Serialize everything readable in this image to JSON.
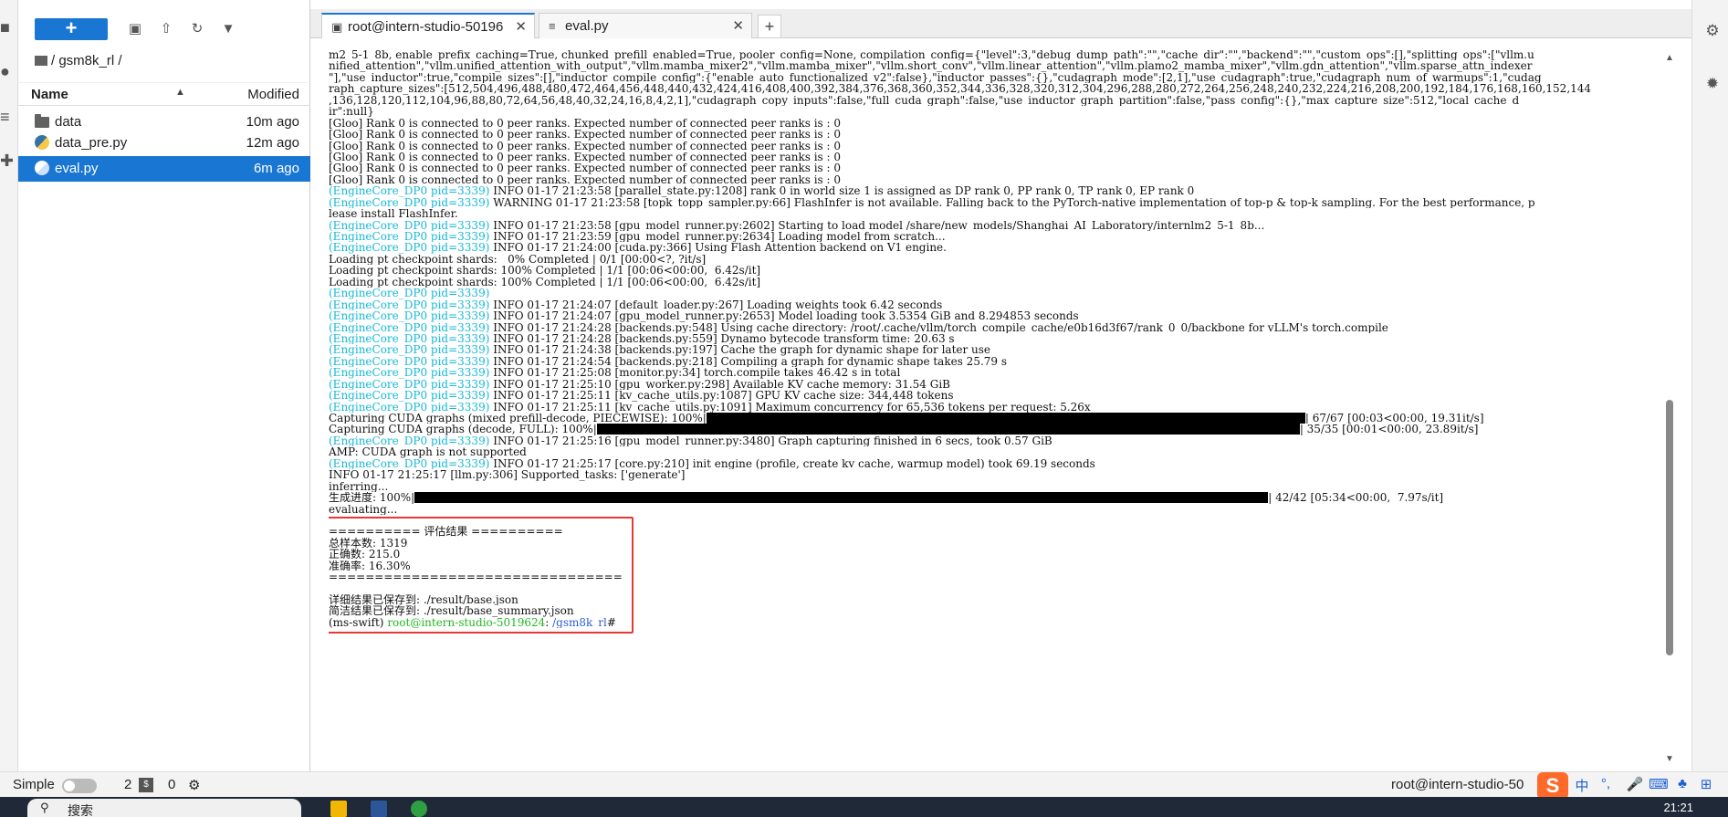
{
  "filebrowser": {
    "new_label": "+",
    "toolbar_icons": [
      "new-folder-icon",
      "upload-icon",
      "refresh-icon",
      "filter-icon"
    ],
    "breadcrumb": "/ gsm8k_rl /",
    "header": {
      "name": "Name",
      "modified": "Modified"
    },
    "files": [
      {
        "name": "data",
        "modified": "10m ago",
        "type": "folder"
      },
      {
        "name": "data_pre.py",
        "modified": "12m ago",
        "type": "python"
      },
      {
        "name": "eval.py",
        "modified": "6m ago",
        "type": "python",
        "selected": true
      }
    ]
  },
  "tabs": [
    {
      "label": "root@intern-studio-50196",
      "icon": "terminal-icon",
      "active": true
    },
    {
      "label": "eval.py",
      "icon": "file-icon",
      "active": false
    }
  ],
  "terminal": {
    "lines": [
      "m2_5-1_8b, enable_prefix_caching=True, chunked_prefill_enabled=True, pooler_config=None, compilation_config={\"level\":3,\"debug_dump_path\":\"\",\"cache_dir\":\"\",\"backend\":\"\",\"custom_ops\":[],\"splitting_ops\":[\"vllm.u",
      "nified_attention\",\"vllm.unified_attention_with_output\",\"vllm.mamba_mixer2\",\"vllm.mamba_mixer\",\"vllm.short_conv\",\"vllm.linear_attention\",\"vllm.plamo2_mamba_mixer\",\"vllm.gdn_attention\",\"vllm.sparse_attn_indexer",
      "\"],\"use_inductor\":true,\"compile_sizes\":[],\"inductor_compile_config\":{\"enable_auto_functionalized_v2\":false},\"inductor_passes\":{},\"cudagraph_mode\":[2,1],\"use_cudagraph\":true,\"cudagraph_num_of_warmups\":1,\"cudag",
      "raph_capture_sizes\":[512,504,496,488,480,472,464,456,448,440,432,424,416,408,400,392,384,376,368,360,352,344,336,328,320,312,304,296,288,280,272,264,256,248,240,232,224,216,208,200,192,184,176,168,160,152,144",
      ",136,128,120,112,104,96,88,80,72,64,56,48,40,32,24,16,8,4,2,1],\"cudagraph_copy_inputs\":false,\"full_cuda_graph\":false,\"use_inductor_graph_partition\":false,\"pass_config\":{},\"max_capture_size\":512,\"local_cache_d",
      "ir\":null}",
      "[Gloo] Rank 0 is connected to 0 peer ranks. Expected number of connected peer ranks is : 0",
      "[Gloo] Rank 0 is connected to 0 peer ranks. Expected number of connected peer ranks is : 0",
      "[Gloo] Rank 0 is connected to 0 peer ranks. Expected number of connected peer ranks is : 0",
      "[Gloo] Rank 0 is connected to 0 peer ranks. Expected number of connected peer ranks is : 0",
      "[Gloo] Rank 0 is connected to 0 peer ranks. Expected number of connected peer ranks is : 0",
      "[Gloo] Rank 0 is connected to 0 peer ranks. Expected number of connected peer ranks is : 0",
      "<P> INFO 01-17 21:23:58 [parallel_state.py:1208] rank 0 in world size 1 is assigned as DP rank 0, PP rank 0, TP rank 0, EP rank 0",
      "<P> WARNING 01-17 21:23:58 [topk_topp_sampler.py:66] FlashInfer is not available. Falling back to the PyTorch-native implementation of top-p & top-k sampling. For the best performance, p",
      "lease install FlashInfer.",
      "<P> INFO 01-17 21:23:58 [gpu_model_runner.py:2602] Starting to load model /share/new_models/Shanghai_AI_Laboratory/internlm2_5-1_8b...",
      "<P> INFO 01-17 21:23:59 [gpu_model_runner.py:2634] Loading model from scratch...",
      "<P> INFO 01-17 21:24:00 [cuda.py:366] Using Flash Attention backend on V1 engine.",
      "Loading pt checkpoint shards:   0% Completed | 0/1 [00:00<?, ?it/s]",
      "Loading pt checkpoint shards: 100% Completed | 1/1 [00:06<00:00,  6.42s/it]",
      "Loading pt checkpoint shards: 100% Completed | 1/1 [00:06<00:00,  6.42s/it]",
      "<P>",
      "<P> INFO 01-17 21:24:07 [default_loader.py:267] Loading weights took 6.42 seconds",
      "<P> INFO 01-17 21:24:07 [gpu_model_runner.py:2653] Model loading took 3.5354 GiB and 8.294853 seconds",
      "<P> INFO 01-17 21:24:28 [backends.py:548] Using cache directory: /root/.cache/vllm/torch_compile_cache/e0b16d3f67/rank_0_0/backbone for vLLM's torch.compile",
      "<P> INFO 01-17 21:24:28 [backends.py:559] Dynamo bytecode transform time: 20.63 s",
      "<P> INFO 01-17 21:24:38 [backends.py:197] Cache the graph for dynamic shape for later use",
      "<P> INFO 01-17 21:24:54 [backends.py:218] Compiling a graph for dynamic shape takes 25.79 s",
      "<P> INFO 01-17 21:25:08 [monitor.py:34] torch.compile takes 46.42 s in total",
      "<P> INFO 01-17 21:25:10 [gpu_worker.py:298] Available KV cache memory: 31.54 GiB",
      "<P> INFO 01-17 21:25:11 [kv_cache_utils.py:1087] GPU KV cache size: 344,448 tokens",
      "<P> INFO 01-17 21:25:11 [kv_cache_utils.py:1091] Maximum concurrency for 65,536 tokens per request: 5.26x",
      "<B1>",
      "<B2>",
      "<P> INFO 01-17 21:25:16 [gpu_model_runner.py:3480] Graph capturing finished in 6 secs, took 0.57 GiB",
      "AMP: CUDA graph is not supported",
      "<P> INFO 01-17 21:25:17 [core.py:210] init engine (profile, create kv cache, warmup model) took 69.19 seconds",
      "INFO 01-17 21:25:17 [llm.py:306] Supported_tasks: ['generate']",
      "inferring...",
      "<B3>",
      "evaluating...",
      "",
      "========== 评估结果 ==========",
      "总样本数: 1319",
      "正确数: 215.0",
      "准确率: 16.30%",
      "================================",
      "",
      "详细结果已保存到: ./result/base.json",
      "简洁结果已保存到: ./result/base_summary.json",
      "<PROMPT>"
    ],
    "engine_prefix": "(EngineCore_DP0 pid=3339)",
    "bar1": {
      "left": "Capturing CUDA graphs (mixed prefill-decode, PIECEWISE): 100%|",
      "right": "| 67/67 [00:03<00:00, 19.31it/s]",
      "progress": 1.0
    },
    "bar2": {
      "left": "Capturing CUDA graphs (decode, FULL): 100%|",
      "right": "| 35/35 [00:01<00:00, 23.89it/s]",
      "progress": 1.0
    },
    "bar3": {
      "left": "生成进度: 100%|",
      "right": "| 42/42 [05:34<00:00,  7.97s/it]",
      "progress": 1.0
    },
    "prompt": {
      "env": "(ms-swift) ",
      "user": "root@intern-studio-5019624",
      "sep": ": ",
      "path": "/gsm8k_rl",
      "end": "#"
    },
    "highlight_color": "#e53935"
  },
  "status": {
    "mode_label": "Simple",
    "count_a": "2",
    "count_b": "0",
    "host": "root@intern-studio-50",
    "ime_lang": "中"
  },
  "taskbar": {
    "search_placeholder": "搜索",
    "clock": "21:21"
  },
  "colors": {
    "accent": "#1976d2",
    "prefix": "#17b9d6",
    "prompt_user": "#22b822",
    "prompt_path": "#2b5cd6"
  }
}
